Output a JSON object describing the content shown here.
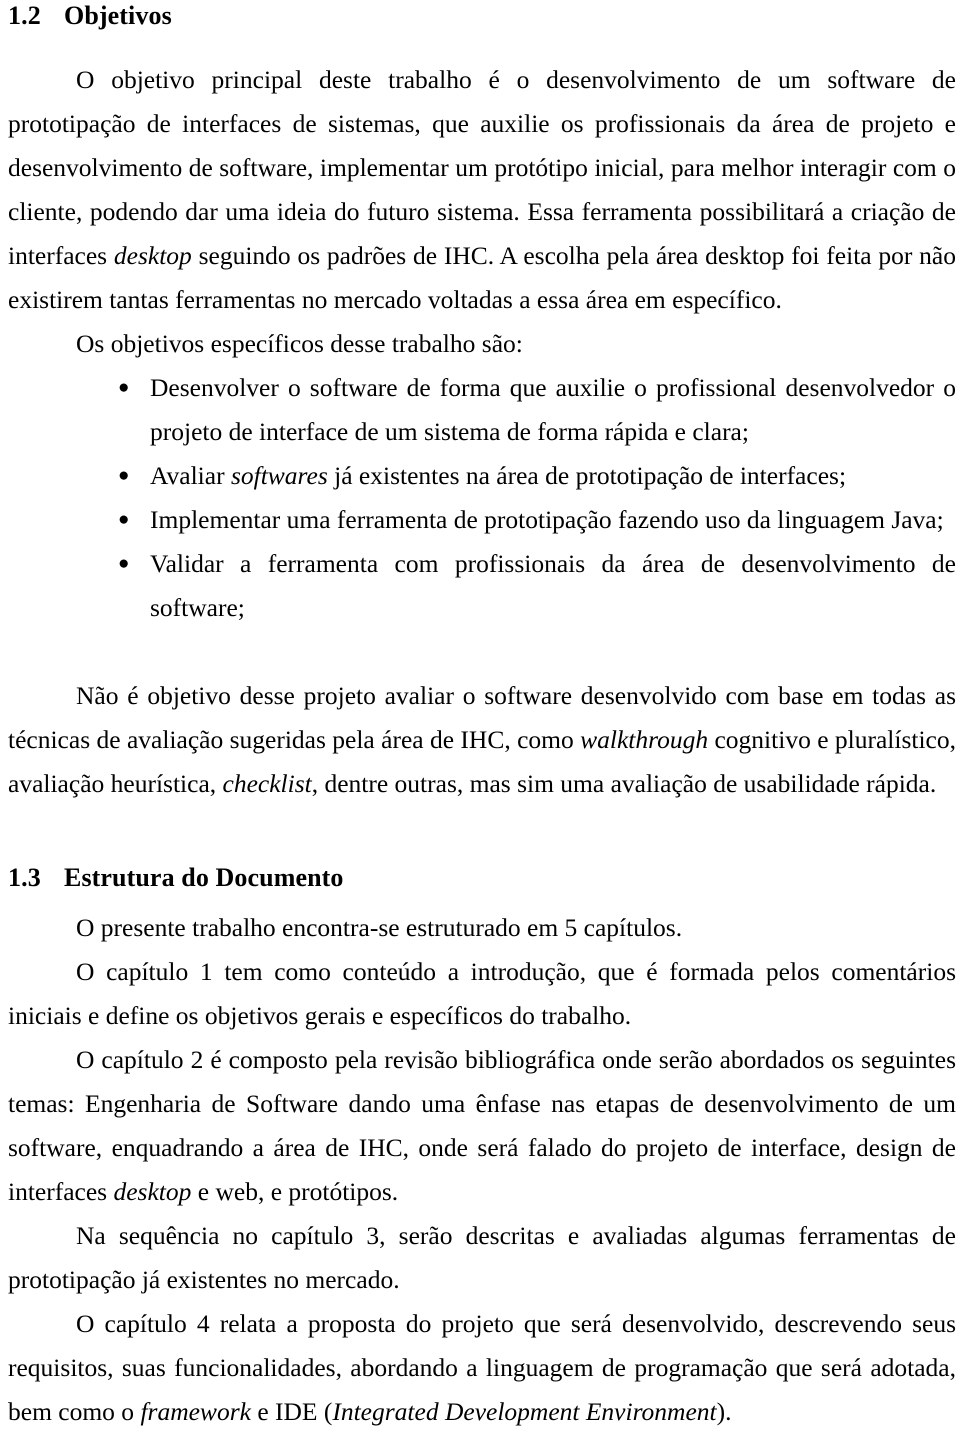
{
  "document": {
    "language": "pt-BR",
    "page_background": "#ffffff",
    "text_color": "#000000"
  },
  "sections": [
    {
      "number": "1.2",
      "title": "Objetivos"
    },
    {
      "number": "1.3",
      "title": "Estrutura do Documento"
    }
  ],
  "section_1_2": {
    "heading_number": "1.2",
    "heading_title": "Objetivos",
    "paragraph_1": {
      "part_1": "O objetivo principal deste trabalho é o desenvolvimento de um software de prototipação de interfaces de sistemas, que auxilie os profissionais da área de projeto e desenvolvimento de software, implementar um protótipo inicial, para melhor interagir com o cliente, podendo dar uma ideia do futuro sistema. Essa ferramenta possibilitará a criação de interfaces ",
      "italic_1": "desktop",
      "part_2": " seguindo os padrões de IHC. A escolha pela área desktop foi feita por não existirem tantas ferramentas no mercado voltadas a essa área em específico."
    },
    "paragraph_2": "Os objetivos específicos desse trabalho são:",
    "bullet_symbol": "●",
    "objectives": [
      {
        "part_1": "Desenvolver o software de forma que auxilie o profissional desenvolvedor o projeto de interface de um sistema de forma rápida e clara;",
        "italic_1": "",
        "part_2": ""
      },
      {
        "part_1": "Avaliar ",
        "italic_1": "softwares",
        "part_2": " já existentes na área de prototipação de interfaces;"
      },
      {
        "part_1": "Implementar uma ferramenta de prototipação fazendo uso da linguagem Java;",
        "italic_1": "",
        "part_2": ""
      },
      {
        "part_1": "Validar a ferramenta com profissionais da área de desenvolvimento de software;",
        "italic_1": "",
        "part_2": ""
      }
    ],
    "paragraph_3": {
      "part_1": "Não é objetivo desse projeto avaliar o software desenvolvido com base em todas as técnicas de avaliação sugeridas pela área de IHC, como ",
      "italic_1": "walkthrough",
      "part_2": " cognitivo e pluralístico, avaliação heurística, ",
      "italic_2": "checklist",
      "part_3": ", dentre outras, mas sim uma avaliação de usabilidade rápida."
    }
  },
  "section_1_3": {
    "heading_number": "1.3",
    "heading_title": "Estrutura do Documento",
    "paragraph_1": "O presente trabalho encontra-se estruturado em 5 capítulos.",
    "paragraph_2": "O capítulo 1 tem como conteúdo a introdução, que é formada pelos comentários iniciais e define os objetivos gerais e específicos do trabalho.",
    "paragraph_3": {
      "part_1": "O capítulo 2 é composto pela revisão bibliográfica onde serão abordados os seguintes temas: Engenharia de Software dando uma ênfase nas etapas de desenvolvimento de um software, enquadrando a área de IHC, onde será falado do projeto de interface, design de interfaces ",
      "italic_1": "desktop",
      "part_2": " e web, e protótipos."
    },
    "paragraph_4": "Na sequência no capítulo 3, serão descritas e avaliadas algumas ferramentas de prototipação já existentes no mercado.",
    "paragraph_5": {
      "part_1": "O capítulo 4 relata a proposta do projeto que será desenvolvido, descrevendo seus requisitos, suas funcionalidades, abordando a linguagem de programação que será adotada, bem como o ",
      "italic_1": "framework",
      "part_2": " e IDE (",
      "italic_2": "Integrated Development Environment",
      "part_3": ")."
    }
  }
}
